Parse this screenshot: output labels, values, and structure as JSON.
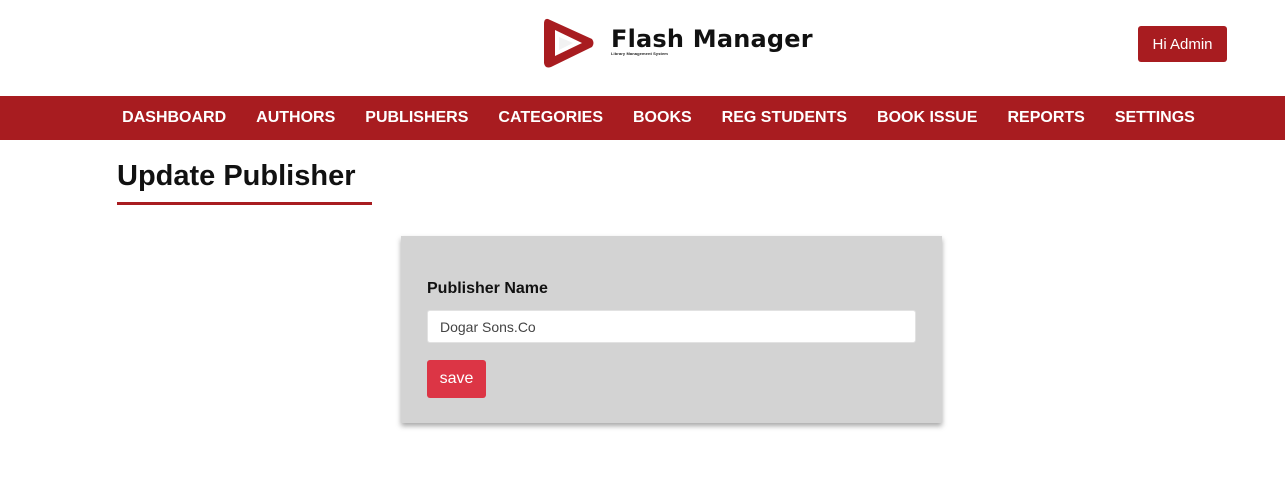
{
  "header": {
    "logo_title": "Flash Manager",
    "logo_subtitle": "Library Management System",
    "admin_button": "Hi Admin"
  },
  "nav": {
    "items": [
      {
        "label": "DASHBOARD"
      },
      {
        "label": "AUTHORS"
      },
      {
        "label": "PUBLISHERS"
      },
      {
        "label": "CATEGORIES"
      },
      {
        "label": "BOOKS"
      },
      {
        "label": "REG STUDENTS"
      },
      {
        "label": "BOOK ISSUE"
      },
      {
        "label": "REPORTS"
      },
      {
        "label": "SETTINGS"
      }
    ]
  },
  "main": {
    "title": "Update Publisher",
    "form": {
      "publisher_label": "Publisher Name",
      "publisher_value": "Dogar Sons.Co",
      "save_label": "save"
    }
  },
  "colors": {
    "brand": "#a81c20",
    "save": "#dc3545",
    "card": "#d3d3d3"
  },
  "icons": {
    "logo": "play-triangle-icon"
  }
}
